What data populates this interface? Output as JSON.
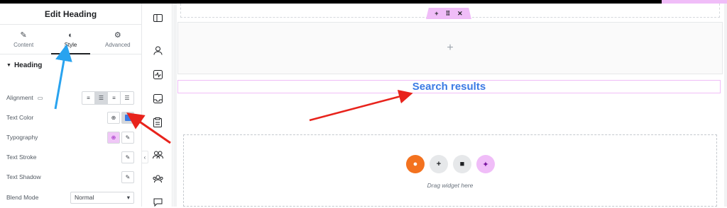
{
  "panel": {
    "title": "Edit Heading",
    "tabs": [
      {
        "label": "Content",
        "icon": "pencil-icon"
      },
      {
        "label": "Style",
        "icon": "contrast-icon"
      },
      {
        "label": "Advanced",
        "icon": "gear-icon"
      }
    ],
    "section": "Heading",
    "controls": {
      "alignment": "Alignment",
      "text_color": "Text Color",
      "typography": "Typography",
      "text_stroke": "Text Stroke",
      "text_shadow": "Text Shadow",
      "blend_mode": "Blend Mode",
      "blend_mode_value": "Normal"
    }
  },
  "strip_icons": [
    "sidebar-layout-icon",
    "user-icon",
    "activity-icon",
    "inbox-icon",
    "clipboard-icon",
    "users-icon",
    "users-alt-icon",
    "chat-icon"
  ],
  "canvas": {
    "heading_text": "Search results",
    "drop_text": "Drag widget here",
    "heading_color": "#3b7be4",
    "accent_pink": "#f0bdf8",
    "orange": "#f3721f"
  },
  "annotations": {
    "blue_arrow_color": "#29a3ef",
    "red_arrow_color": "#e8231c"
  }
}
